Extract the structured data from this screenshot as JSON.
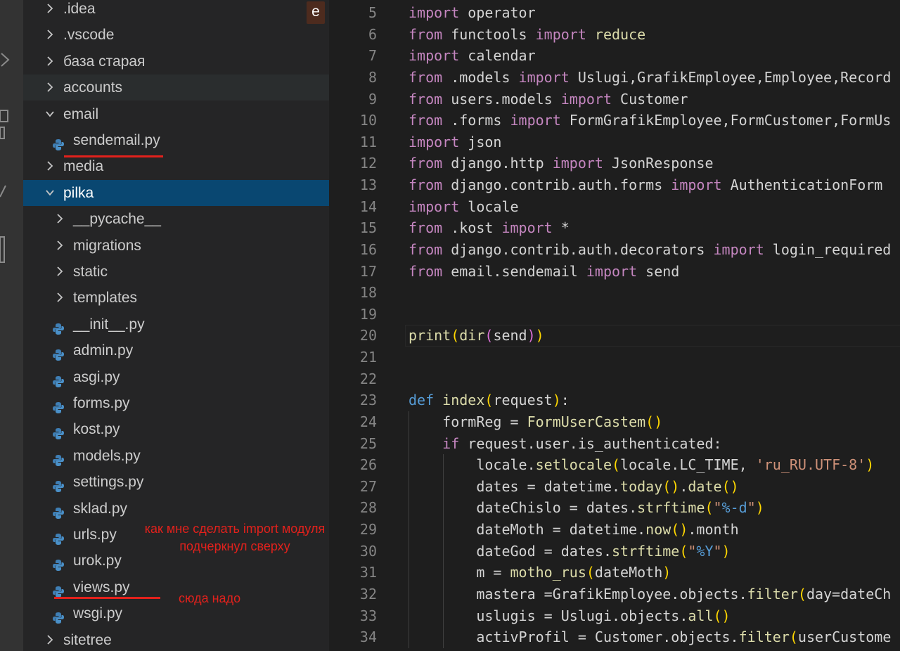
{
  "explorer": {
    "tab_badge": "e",
    "items": [
      {
        "label": ".idea",
        "kind": "folder",
        "open": false
      },
      {
        "label": ".vscode",
        "kind": "folder",
        "open": false
      },
      {
        "label": "база старая",
        "kind": "folder",
        "open": false
      },
      {
        "label": "accounts",
        "kind": "folder",
        "open": false
      },
      {
        "label": "email",
        "kind": "folder",
        "open": true
      },
      {
        "label": "sendemail.py",
        "kind": "python-file"
      },
      {
        "label": "media",
        "kind": "folder",
        "open": false
      },
      {
        "label": "pilka",
        "kind": "folder",
        "open": true
      },
      {
        "label": "__pycache__",
        "kind": "folder",
        "open": false
      },
      {
        "label": "migrations",
        "kind": "folder",
        "open": false
      },
      {
        "label": "static",
        "kind": "folder",
        "open": false
      },
      {
        "label": "templates",
        "kind": "folder",
        "open": false
      },
      {
        "label": "__init__.py",
        "kind": "python-file"
      },
      {
        "label": "admin.py",
        "kind": "python-file"
      },
      {
        "label": "asgi.py",
        "kind": "python-file"
      },
      {
        "label": "forms.py",
        "kind": "python-file"
      },
      {
        "label": "kost.py",
        "kind": "python-file"
      },
      {
        "label": "models.py",
        "kind": "python-file"
      },
      {
        "label": "settings.py",
        "kind": "python-file"
      },
      {
        "label": "sklad.py",
        "kind": "python-file"
      },
      {
        "label": "urls.py",
        "kind": "python-file"
      },
      {
        "label": "urok.py",
        "kind": "python-file"
      },
      {
        "label": "views.py",
        "kind": "python-file"
      },
      {
        "label": "wsgi.py",
        "kind": "python-file"
      },
      {
        "label": "sitetree",
        "kind": "folder",
        "open": false
      }
    ]
  },
  "annotations": {
    "question_line1": "как мне сделать import модуля",
    "question_line2": "подчеркнул сверху",
    "target_note": "сюда надо"
  },
  "editor": {
    "lines": [
      {
        "n": "5",
        "text": "import operator"
      },
      {
        "n": "6",
        "text": "from functools import reduce"
      },
      {
        "n": "7",
        "text": "import calendar"
      },
      {
        "n": "8",
        "text": "from .models import Uslugi,GrafikEmployee,Employee,Record"
      },
      {
        "n": "9",
        "text": "from users.models import Customer"
      },
      {
        "n": "10",
        "text": "from .forms import FormGrafikEmployee,FormCustomer,FormUs"
      },
      {
        "n": "11",
        "text": "import json"
      },
      {
        "n": "12",
        "text": "from django.http import JsonResponse"
      },
      {
        "n": "13",
        "text": "from django.contrib.auth.forms import AuthenticationForm"
      },
      {
        "n": "14",
        "text": "import locale"
      },
      {
        "n": "15",
        "text": "from .kost import *"
      },
      {
        "n": "16",
        "text": "from django.contrib.auth.decorators import login_required"
      },
      {
        "n": "17",
        "text": "from email.sendemail import send"
      },
      {
        "n": "18",
        "text": ""
      },
      {
        "n": "19",
        "text": ""
      },
      {
        "n": "20",
        "text": "print(dir(send))"
      },
      {
        "n": "21",
        "text": ""
      },
      {
        "n": "22",
        "text": ""
      },
      {
        "n": "23",
        "text": "def index(request):"
      },
      {
        "n": "24",
        "text": "    formReg = FormUserCastem()"
      },
      {
        "n": "25",
        "text": "    if request.user.is_authenticated:"
      },
      {
        "n": "26",
        "text": "        locale.setlocale(locale.LC_TIME, 'ru_RU.UTF-8')"
      },
      {
        "n": "27",
        "text": "        dates = datetime.today().date()"
      },
      {
        "n": "28",
        "text": "        dateChislo = dates.strftime(\"%-d\")"
      },
      {
        "n": "29",
        "text": "        dateMoth = datetime.now().month"
      },
      {
        "n": "30",
        "text": "        dateGod = dates.strftime(\"%Y\")"
      },
      {
        "n": "31",
        "text": "        m = motho_rus(dateMoth)"
      },
      {
        "n": "32",
        "text": "        mastera =GrafikEmployee.objects.filter(day=dateCh"
      },
      {
        "n": "33",
        "text": "        uslugis = Uslugi.objects.all()"
      },
      {
        "n": "34",
        "text": "        activProfil = Customer.objects.filter(userCustome"
      }
    ]
  }
}
